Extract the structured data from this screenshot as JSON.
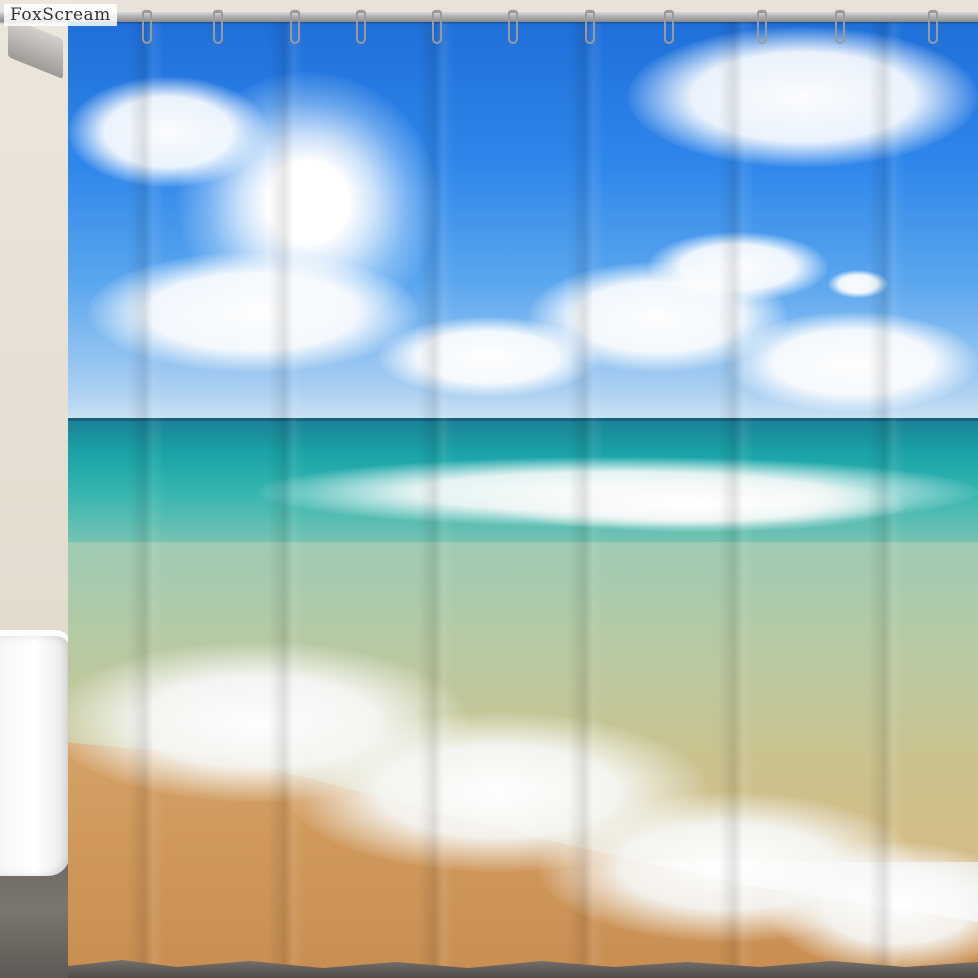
{
  "watermark": {
    "text": "FoxScream"
  },
  "scene": {
    "subject": "beach-shower-curtain",
    "colors": {
      "sky_top": "#1f6fd8",
      "sky_horizon": "#cfe3f3",
      "sea_deep": "#1b7f94",
      "sea_turquoise": "#38b6b0",
      "sand": "#d09a5c",
      "foam": "#ffffff"
    }
  }
}
